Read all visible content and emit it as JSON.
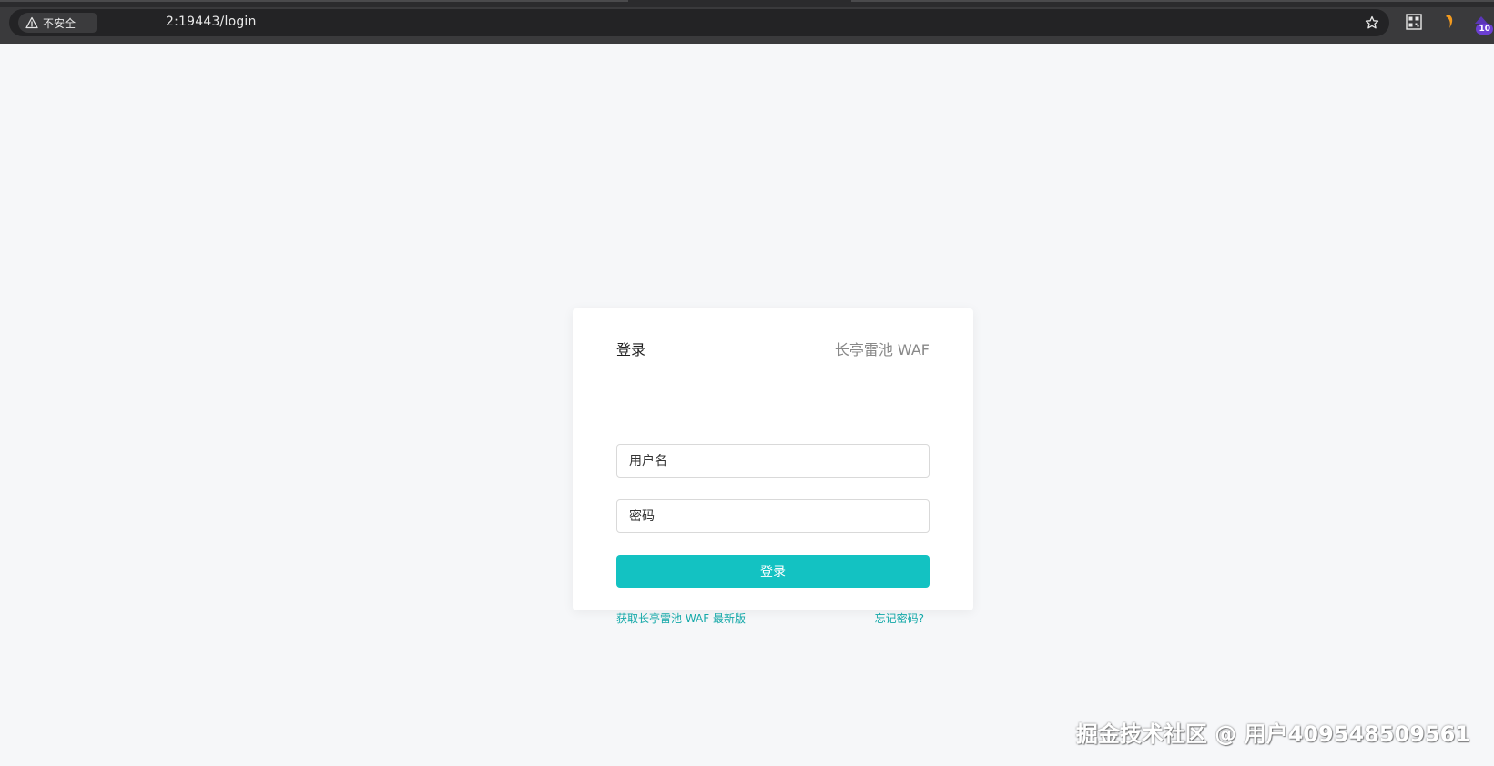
{
  "browser": {
    "security_label": "不安全",
    "url": "2:19443/login",
    "extension_badge_count": "10"
  },
  "login": {
    "title": "登录",
    "brand": "长亭雷池 WAF",
    "username_placeholder": "用户名",
    "password_placeholder": "密码",
    "submit_label": "登录",
    "download_link": "获取长亭雷池 WAF 最新版",
    "forgot_link": "忘记密码?"
  },
  "watermark": "掘金技术社区 @ 用户409548509561",
  "colors": {
    "primary": "#13c2c2",
    "link": "#13a8a8",
    "page_bg": "#f6f7f9",
    "browser_bar": "#3a3a3c"
  }
}
